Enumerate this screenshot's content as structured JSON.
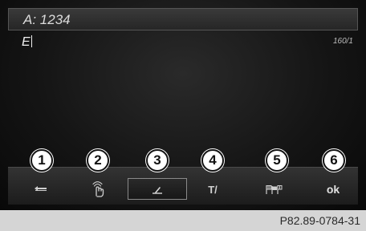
{
  "header": {
    "address_label": "A: 1234"
  },
  "editor": {
    "text": "E",
    "counter": "160/1"
  },
  "toolbar": {
    "items": [
      {
        "icon": "back-arrow-icon"
      },
      {
        "icon": "handwriting-icon"
      },
      {
        "icon": "pen-icon",
        "selected": true
      },
      {
        "label": "T/",
        "icon": "text-format-icon"
      },
      {
        "icon": "flags-icon"
      },
      {
        "label": "ok"
      }
    ]
  },
  "callouts": [
    "1",
    "2",
    "3",
    "4",
    "5",
    "6"
  ],
  "caption": "P82.89-0784-31"
}
